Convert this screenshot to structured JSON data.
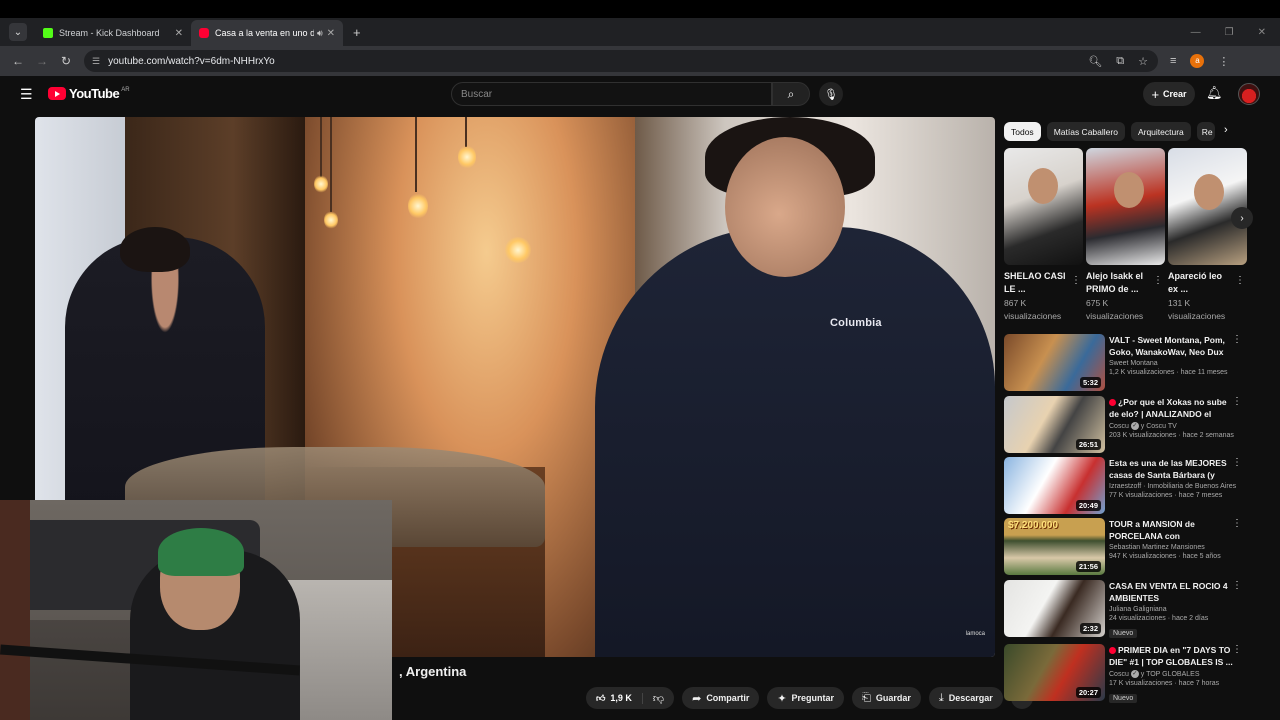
{
  "browser": {
    "tabs": [
      {
        "title": "Stream - Kick Dashboard",
        "favicon": "kick-icon",
        "active": false
      },
      {
        "title": "Casa a la venta en uno de l",
        "favicon": "youtube-icon",
        "active": true
      }
    ],
    "url": "youtube.com/watch?v=6dm-NHHrxYo"
  },
  "youtube": {
    "logo_text": "YouTube",
    "region": "AR",
    "search_placeholder": "Buscar",
    "create_label": "Crear"
  },
  "video": {
    "title_visible": ", Argentina",
    "watermark": "lamoca",
    "shirt_logo": "Columbia",
    "actions": {
      "likes": "1,9 K",
      "share": "Compartir",
      "ask": "Preguntar",
      "save": "Guardar",
      "download": "Descargar"
    }
  },
  "chips": [
    "Todos",
    "Matías Caballero",
    "Arquitectura",
    "Re"
  ],
  "shorts": [
    {
      "title": "SHELAO CASI LE ...",
      "views": "867 K visualizaciones"
    },
    {
      "title": "Alejo Isakk el PRIMO de ...",
      "views": "675 K visualizaciones"
    },
    {
      "title": "Apareció leo ex ...",
      "views": "131 K visualizaciones"
    }
  ],
  "recommended": [
    {
      "title": "VALT - Sweet Montana, Pom, Goko, WanakoWav, Neo Dux",
      "channel": "Sweet Montana",
      "views": "1,2 K visualizaciones",
      "age": "hace 11 meses",
      "duration": "5:32",
      "live": false,
      "verified": false,
      "badge": ""
    },
    {
      "title": "¿Por que el Xokas no sube de elo? | ANALIZANDO el ROA...",
      "channel": "Coscu",
      "channel_extra": "y Coscu TV",
      "views": "203 K visualizaciones",
      "age": "hace 2 semanas",
      "duration": "26:51",
      "live": true,
      "verified": true,
      "badge": ""
    },
    {
      "title": "Esta es una de las MEJORES casas de Santa Bárbara (y est...",
      "channel": "Izraestzoff · Inmobiliaria de Buenos Aires",
      "views": "77 K visualizaciones",
      "age": "hace 7 meses",
      "duration": "20:49",
      "live": false,
      "verified": false,
      "badge": ""
    },
    {
      "title": "TOUR  a MANSION de PORCELANA con ESCALERAS ...",
      "channel": "Sebastian Martinez Mansiones",
      "views": "947 K visualizaciones",
      "age": "hace 5 años",
      "duration": "21:56",
      "live": false,
      "verified": false,
      "badge": "",
      "thumb_text": "$7.200.000"
    },
    {
      "title": "CASA EN VENTA EL ROCIO 4 AMBIENTES",
      "channel": "Juliana Galigniana",
      "views": "24 visualizaciones",
      "age": "hace 2 días",
      "duration": "2:32",
      "live": false,
      "verified": false,
      "badge": "Nuevo"
    },
    {
      "title": "PRIMER DIA en \"7 DAYS TO DIE\" #1 | TOP GLOBALES IS ...",
      "channel": "Coscu",
      "channel_extra": "y TOP GLOBALES",
      "views": "17 K visualizaciones",
      "age": "hace 7 horas",
      "duration": "20:27",
      "live": true,
      "verified": true,
      "badge": "Nuevo"
    }
  ]
}
